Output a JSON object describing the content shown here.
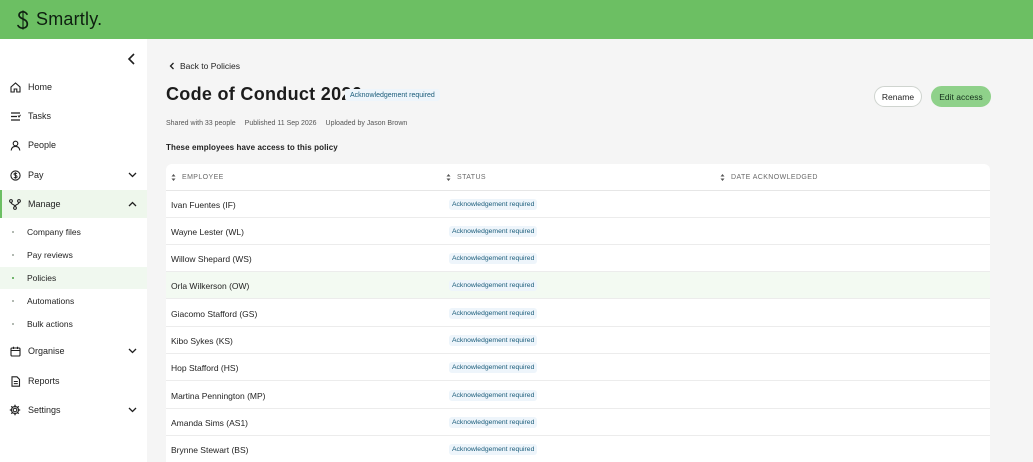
{
  "app": {
    "name": "Smartly.",
    "brand_color": "#6cbf63"
  },
  "sidebar": {
    "collapse_icon": "chevron-left-icon",
    "items": [
      {
        "label": "Home",
        "icon": "home-icon"
      },
      {
        "label": "Tasks",
        "icon": "tasks-icon"
      },
      {
        "label": "People",
        "icon": "person-icon"
      },
      {
        "label": "Pay",
        "icon": "dollar-icon",
        "expandable": true
      },
      {
        "label": "Manage",
        "icon": "manage-icon",
        "expandable": true,
        "expanded": true,
        "active": true
      },
      {
        "label": "Organise",
        "icon": "calendar-icon",
        "expandable": true
      },
      {
        "label": "Reports",
        "icon": "report-icon"
      },
      {
        "label": "Settings",
        "icon": "gear-icon",
        "expandable": true
      }
    ],
    "manage_sub": [
      {
        "label": "Company files"
      },
      {
        "label": "Pay reviews"
      },
      {
        "label": "Policies",
        "active": true
      },
      {
        "label": "Automations"
      },
      {
        "label": "Bulk actions"
      }
    ]
  },
  "main": {
    "back_label": "Back to Policies",
    "title": "Code of Conduct 2026",
    "title_badge": "Acknowledgement required",
    "buttons": {
      "rename": "Rename",
      "edit_access": "Edit access"
    },
    "meta": {
      "shared": "Shared with 33 people",
      "published": "Published 11 Sep 2026",
      "uploaded": "Uploaded by Jason Brown"
    },
    "section_label": "These employees have access to this policy",
    "table": {
      "columns": [
        "EMPLOYEE",
        "STATUS",
        "DATE ACKNOWLEDGED"
      ],
      "rows": [
        {
          "employee": "Ivan Fuentes (IF)",
          "status": "Acknowledgement required",
          "date": ""
        },
        {
          "employee": "Wayne Lester (WL)",
          "status": "Acknowledgement required",
          "date": ""
        },
        {
          "employee": "Willow Shepard (WS)",
          "status": "Acknowledgement required",
          "date": ""
        },
        {
          "employee": "Orla Wilkerson (OW)",
          "status": "Acknowledgement required",
          "date": "",
          "highlighted": true
        },
        {
          "employee": "Giacomo Stafford (GS)",
          "status": "Acknowledgement required",
          "date": ""
        },
        {
          "employee": "Kibo Sykes (KS)",
          "status": "Acknowledgement required",
          "date": ""
        },
        {
          "employee": "Hop Stafford (HS)",
          "status": "Acknowledgement required",
          "date": ""
        },
        {
          "employee": "Martina Pennington (MP)",
          "status": "Acknowledgement required",
          "date": ""
        },
        {
          "employee": "Amanda Sims (AS1)",
          "status": "Acknowledgement required",
          "date": ""
        },
        {
          "employee": "Brynne Stewart (BS)",
          "status": "Acknowledgement required",
          "date": ""
        }
      ]
    }
  }
}
